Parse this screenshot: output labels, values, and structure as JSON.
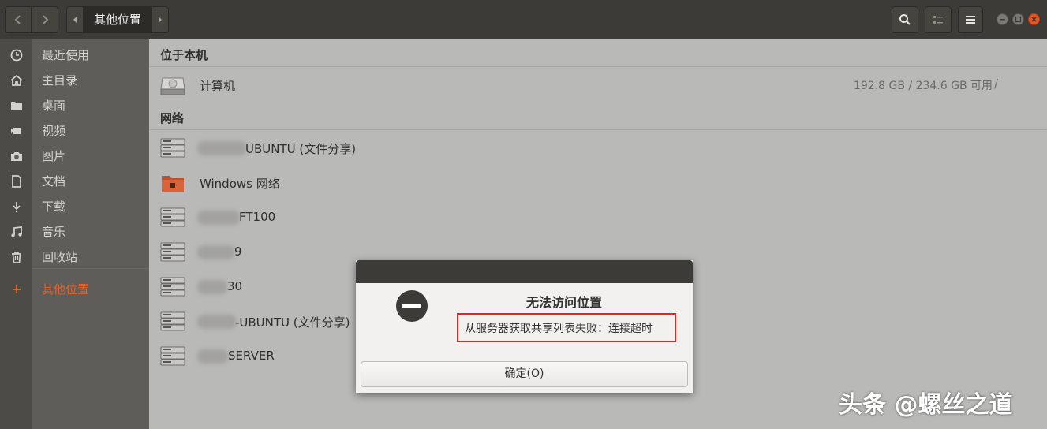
{
  "header": {
    "current_location": "其他位置",
    "icons": {
      "back": "chevron-left-icon",
      "forward": "chevron-right-icon",
      "search": "search-icon",
      "view": "list-view-icon",
      "menu": "hamburger-menu-icon",
      "minimize": "minimize-icon",
      "maximize": "maximize-icon",
      "close": "close-icon"
    }
  },
  "sidebar": {
    "items": [
      {
        "label": "最近使用",
        "icon": "recent-clock-icon"
      },
      {
        "label": "主目录",
        "icon": "home-icon"
      },
      {
        "label": "桌面",
        "icon": "desktop-folder-icon"
      },
      {
        "label": "视频",
        "icon": "video-camera-icon"
      },
      {
        "label": "图片",
        "icon": "camera-icon"
      },
      {
        "label": "文档",
        "icon": "document-icon"
      },
      {
        "label": "下载",
        "icon": "download-icon"
      },
      {
        "label": "音乐",
        "icon": "music-note-icon"
      },
      {
        "label": "回收站",
        "icon": "trash-icon"
      },
      {
        "label": "其他位置",
        "icon": "plus-icon",
        "active": true
      }
    ],
    "active_color": "#e0622b"
  },
  "main": {
    "local_section": {
      "title": "位于本机",
      "computer": {
        "label": "计算机",
        "usage": "192.8 GB / 234.6 GB 可用",
        "path": "/"
      }
    },
    "network_section": {
      "title": "网络",
      "items": [
        {
          "label": "UBUNTU (文件分享)",
          "icon": "network-server-icon"
        },
        {
          "label": "Windows 网络",
          "icon": "windows-network-folder-icon"
        },
        {
          "label": "FT100",
          "icon": "network-server-icon"
        },
        {
          "label": "9",
          "icon": "network-server-icon"
        },
        {
          "label": "30",
          "icon": "network-server-icon"
        },
        {
          "label": "-UBUNTU (文件分享)",
          "icon": "network-server-icon"
        },
        {
          "label": "SERVER",
          "icon": "network-server-icon"
        }
      ]
    }
  },
  "dialog": {
    "heading": "无法访问位置",
    "message": "从服务器获取共享列表失败：连接超时",
    "ok_label": "确定(O)",
    "icon": "error-minus-icon",
    "highlight_color": "#e3261f"
  },
  "watermark": {
    "text": "头条 @螺丝之道"
  }
}
